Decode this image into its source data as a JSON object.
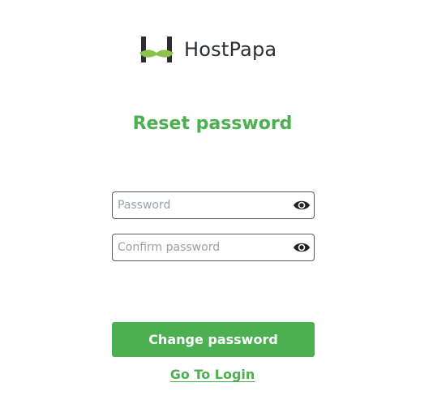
{
  "brand": {
    "name": "HostPapa",
    "logo_icon": "hostpapa-mustache-logo",
    "logo_colors": {
      "letter": "#2b2f33",
      "mustache": "#8bc34a"
    }
  },
  "page": {
    "title": "Reset password"
  },
  "form": {
    "password": {
      "value": "",
      "placeholder": "Password",
      "toggle_icon": "eye-icon"
    },
    "confirm_password": {
      "value": "",
      "placeholder": "Confirm password",
      "toggle_icon": "eye-icon"
    },
    "submit_label": "Change password"
  },
  "links": {
    "login_label": "Go To Login"
  },
  "colors": {
    "accent": "#4caf50",
    "border": "#555c63",
    "placeholder": "#9aa0a6"
  }
}
